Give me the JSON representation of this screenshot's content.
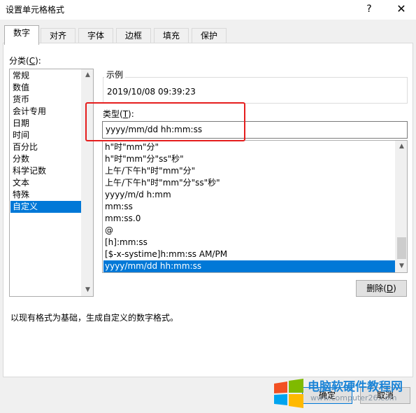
{
  "window": {
    "title": "设置单元格格式",
    "help": "?",
    "close": "✕"
  },
  "tabs": [
    {
      "label": "数字",
      "active": true
    },
    {
      "label": "对齐"
    },
    {
      "label": "字体"
    },
    {
      "label": "边框"
    },
    {
      "label": "填充"
    },
    {
      "label": "保护"
    }
  ],
  "category": {
    "label": "分类(",
    "hotkey": "C",
    "label_end": "):",
    "items": [
      "常规",
      "数值",
      "货币",
      "会计专用",
      "日期",
      "时间",
      "百分比",
      "分数",
      "科学记数",
      "文本",
      "特殊",
      "自定义"
    ],
    "selected": "自定义"
  },
  "sample": {
    "title": "示例",
    "value": "2019/10/08 09:39:23"
  },
  "type": {
    "label": "类型(",
    "hotkey": "T",
    "label_end": "):",
    "value": "yyyy/mm/dd hh:mm:ss",
    "items": [
      "h\"时\"mm\"分\"",
      "h\"时\"mm\"分\"ss\"秒\"",
      "上午/下午h\"时\"mm\"分\"",
      "上午/下午h\"时\"mm\"分\"ss\"秒\"",
      "yyyy/m/d h:mm",
      "mm:ss",
      "mm:ss.0",
      "@",
      "[h]:mm:ss",
      "[$-x-systime]h:mm:ss AM/PM",
      "yyyy/mm/dd hh:mm:ss"
    ],
    "selected": "yyyy/mm/dd hh:mm:ss"
  },
  "buttons": {
    "delete": "删除(",
    "delete_hotkey": "D",
    "delete_end": ")",
    "ok": "确定",
    "cancel": "取消"
  },
  "description": "以现有格式为基础，生成自定义的数字格式。",
  "watermark": {
    "line1": "电脑软硬件教程网",
    "line2": "www.computer26.com"
  },
  "colors": {
    "selection": "#0078d7",
    "highlight_box": "#e51d1d"
  }
}
